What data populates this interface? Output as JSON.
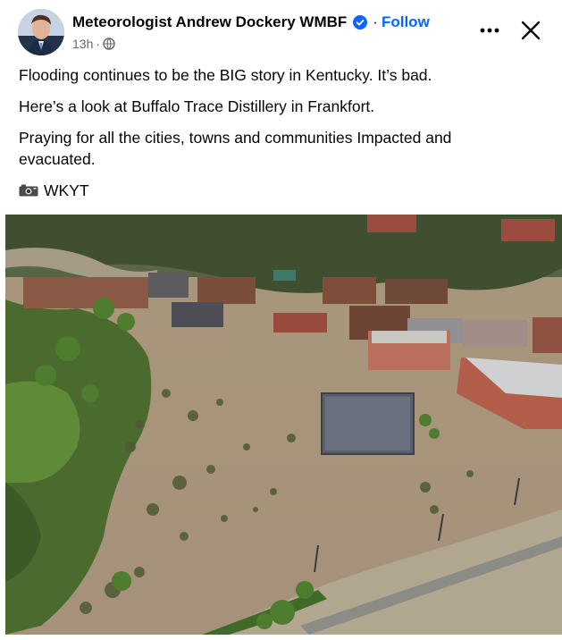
{
  "post": {
    "author": "Meteorologist Andrew Dockery WMBF",
    "dot": "·",
    "follow_label": "Follow",
    "time": "13h",
    "time_sep": "·",
    "text_lines": [
      "Flooding continues to be the BIG story in Kentucky. It’s bad.",
      "Here’s a look at Buffalo Trace Distillery in Frankfort.",
      "Praying for all the cities, towns and communities Impacted and evacuated."
    ],
    "credit": "WKYT",
    "credit_icon": "camera-icon"
  },
  "icons": {
    "verified": "verified-badge-icon",
    "globe": "globe-icon",
    "more": "more-options-icon",
    "close": "close-icon"
  },
  "colors": {
    "link_blue": "#0866ff",
    "meta_grey": "#65676b",
    "text": "#050505",
    "flood_water": "#9c8a72"
  }
}
